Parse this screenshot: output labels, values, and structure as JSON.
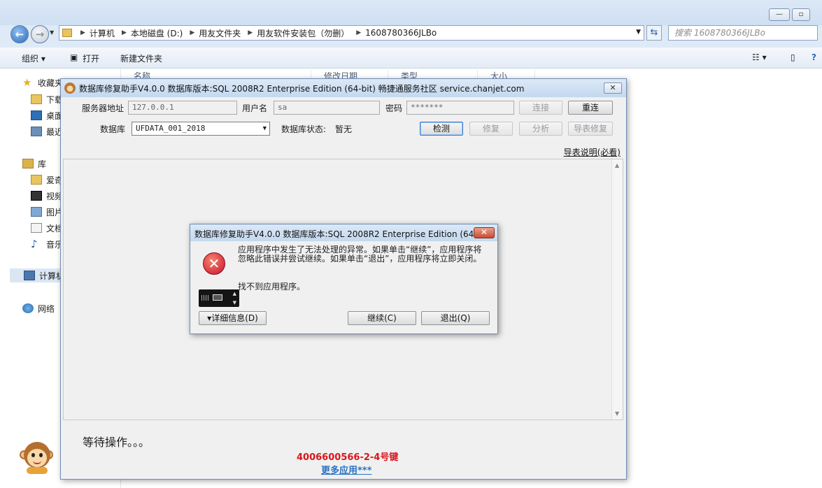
{
  "explorer": {
    "breadcrumbs": [
      "计算机",
      "本地磁盘 (D:)",
      "用友文件夹",
      "用友软件安装包（勿删）",
      "1608780366JLBo"
    ],
    "search_placeholder": "搜索 1608780366JLBo",
    "toolbar": {
      "organize": "组织 ▾",
      "open": "打开",
      "new_folder": "新建文件夹"
    },
    "columns": [
      "名称",
      "修改日期",
      "类型",
      "大小"
    ],
    "sidebar": {
      "favorites": "收藏夹",
      "downloads": "下载",
      "desktop": "桌面",
      "recent": "最近",
      "libraries": "库",
      "iqiyi": "爱奇",
      "videos": "视频",
      "pictures": "图片",
      "documents": "文档",
      "music": "音乐",
      "computer": "计算机",
      "network": "网络"
    }
  },
  "repair": {
    "title": "数据库修复助手V4.0.0 数据库版本:SQL 2008R2 Enterprise Edition (64-bit)  畅捷通服务社区 service.chanjet.com",
    "close_glyph": "✕",
    "server_label": "服务器地址",
    "server_value": "127.0.0.1",
    "user_label": "用户名",
    "user_value": "sa",
    "password_label": "密码",
    "password_value": "*******",
    "connect_btn": "连接",
    "reconnect_btn": "重连",
    "db_label": "数据库",
    "db_value": "UFDATA_001_2018",
    "db_status_label": "数据库状态:",
    "db_status_value": "暂无",
    "check_btn": "检测",
    "repair_btn": "修复",
    "analyze_btn": "分析",
    "table_repair_btn": "导表修复",
    "help_link": "导表说明(必看)",
    "status": "等待操作。。。",
    "phone": "4006600566-2-4号键",
    "more": "更多应用***"
  },
  "error_dialog": {
    "title": "数据库修复助手V4.0.0 数据库版本:SQL 2008R2 Enterprise Edition (64...",
    "close_glyph": "✕",
    "message": "应用程序中发生了无法处理的异常。如果单击“继续”，应用程序将忽略此错误并尝试继续。如果单击“退出”，应用程序将立即关闭。",
    "detail": "找不到应用程序。",
    "details_btn": "▾详细信息(D)",
    "continue_btn": "继续(C)",
    "quit_btn": "退出(Q)"
  }
}
